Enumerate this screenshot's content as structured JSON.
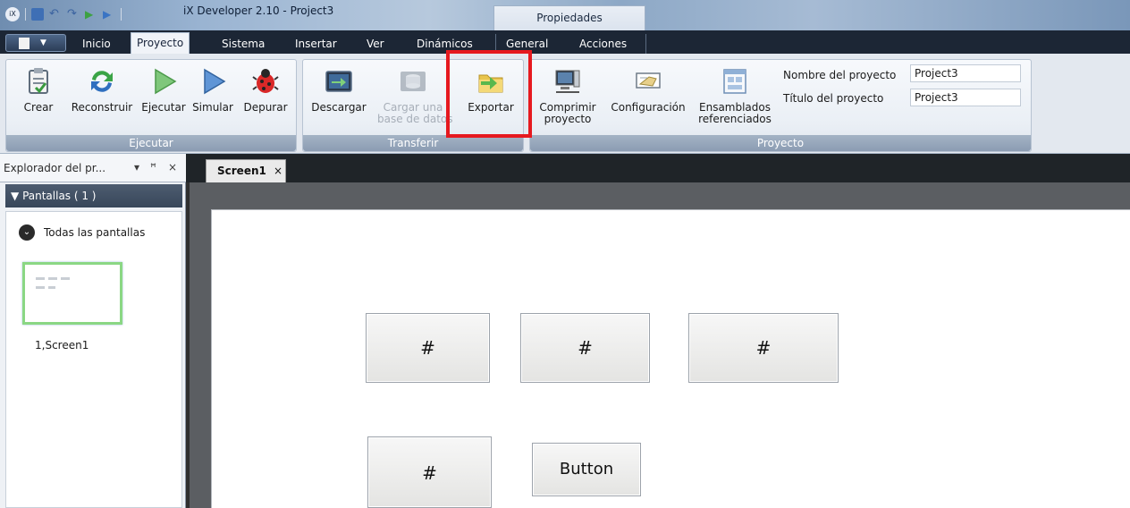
{
  "titlebar": {
    "title": "iX Developer 2.10 - Project3",
    "contextual_tab": "Propiedades"
  },
  "ribbon_tabs": [
    "Inicio",
    "Proyecto",
    "Sistema",
    "Insertar",
    "Ver",
    "Dinámicos",
    "General",
    "Acciones"
  ],
  "active_tab": "Proyecto",
  "groups": {
    "ejecutar": {
      "label": "Ejecutar",
      "buttons": [
        "Crear",
        "Reconstruir",
        "Ejecutar",
        "Simular",
        "Depurar"
      ]
    },
    "transferir": {
      "label": "Transferir",
      "buttons": [
        "Descargar",
        "Cargar una",
        "base de datos",
        "Exportar"
      ]
    },
    "proyecto": {
      "label": "Proyecto",
      "buttons": [
        "Comprimir",
        "proyecto",
        "Configuración",
        "Ensamblados",
        "referenciados"
      ],
      "project_name_label": "Nombre del proyecto",
      "project_name_value": "Project3",
      "project_title_label": "Título del proyecto",
      "project_title_value": "Project3"
    }
  },
  "explorer": {
    "title": "Explorador del pr...",
    "controls": [
      "▾",
      "ꟸ",
      "×"
    ],
    "section": "Pantallas ( 1 )",
    "all_screens": "Todas las pantallas",
    "screen_item": "1,Screen1"
  },
  "document": {
    "tab_label": "Screen1",
    "tab_close": "×",
    "buttons": [
      "#",
      "#",
      "#",
      "#",
      "Button"
    ]
  },
  "colors": {
    "highlight": "#e6191f",
    "thumbnail_border": "#8bd784"
  },
  "icons": [
    "crear-icon",
    "reconstruir-icon",
    "ejecutar-icon",
    "simular-icon",
    "depurar-icon",
    "descargar-icon",
    "cargar-bd-icon",
    "exportar-icon",
    "comprimir-icon",
    "configuracion-icon",
    "ensamblados-icon"
  ]
}
